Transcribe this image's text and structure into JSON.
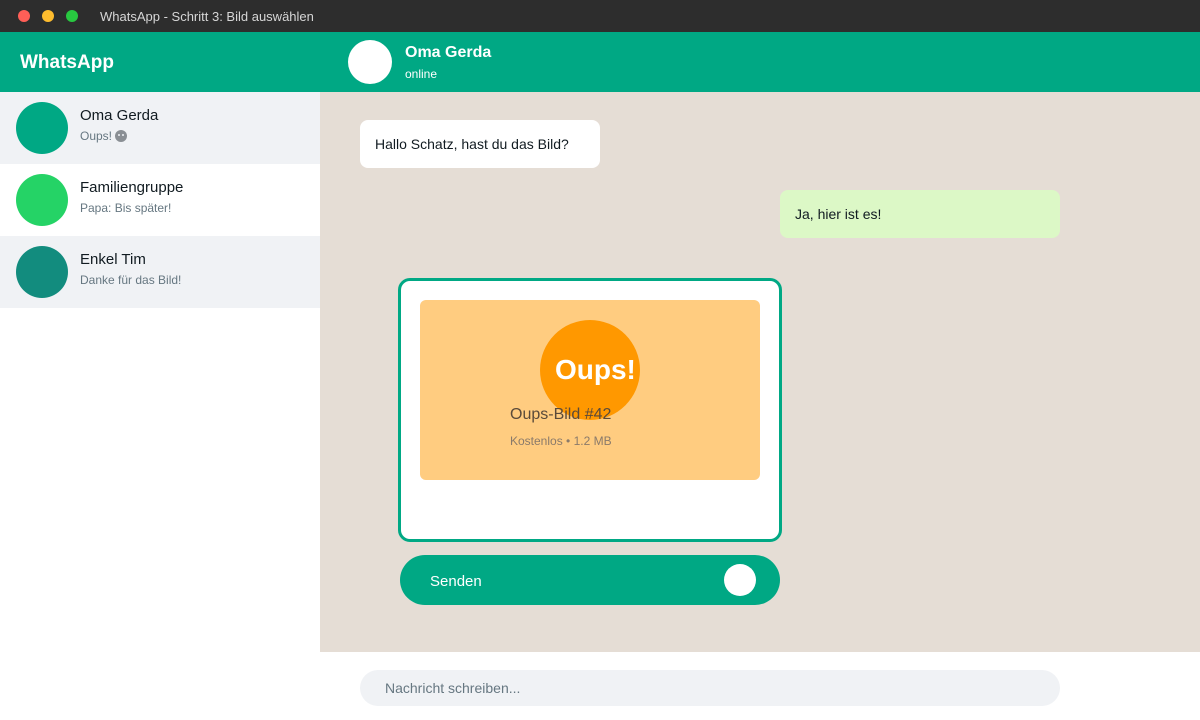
{
  "window": {
    "title": "WhatsApp - Schritt 3: Bild auswählen"
  },
  "sidebar": {
    "app_name": "WhatsApp",
    "chats": [
      {
        "name": "Oma Gerda",
        "preview": "Oups!",
        "preview_icon": "smiley-icon",
        "avatar_color": "#00a884",
        "selected": true
      },
      {
        "name": "Familiengruppe",
        "preview": "Papa: Bis später!",
        "avatar_color": "#25d366",
        "selected": false
      },
      {
        "name": "Enkel Tim",
        "preview": "Danke für das Bild!",
        "avatar_color": "#128c7e",
        "selected": false
      }
    ]
  },
  "chat": {
    "contact_name": "Oma Gerda",
    "status": "online",
    "messages": [
      {
        "direction": "incoming",
        "text": "Hallo Schatz, hast du das Bild?"
      },
      {
        "direction": "outgoing",
        "text": "Ja, hier ist es!"
      }
    ],
    "picker": {
      "image_label": "Oups!",
      "image_name": "Oups-Bild #42",
      "image_meta": "Kostenlos • 1.2 MB",
      "send_label": "Senden"
    },
    "composer": {
      "placeholder": "Nachricht schreiben..."
    }
  },
  "colors": {
    "brand": "#00a884",
    "chat_background": "#e5ddd5",
    "outgoing_bubble": "#dcf8c6",
    "image_card": "#ffcc80",
    "oups_circle": "#ff9800"
  }
}
